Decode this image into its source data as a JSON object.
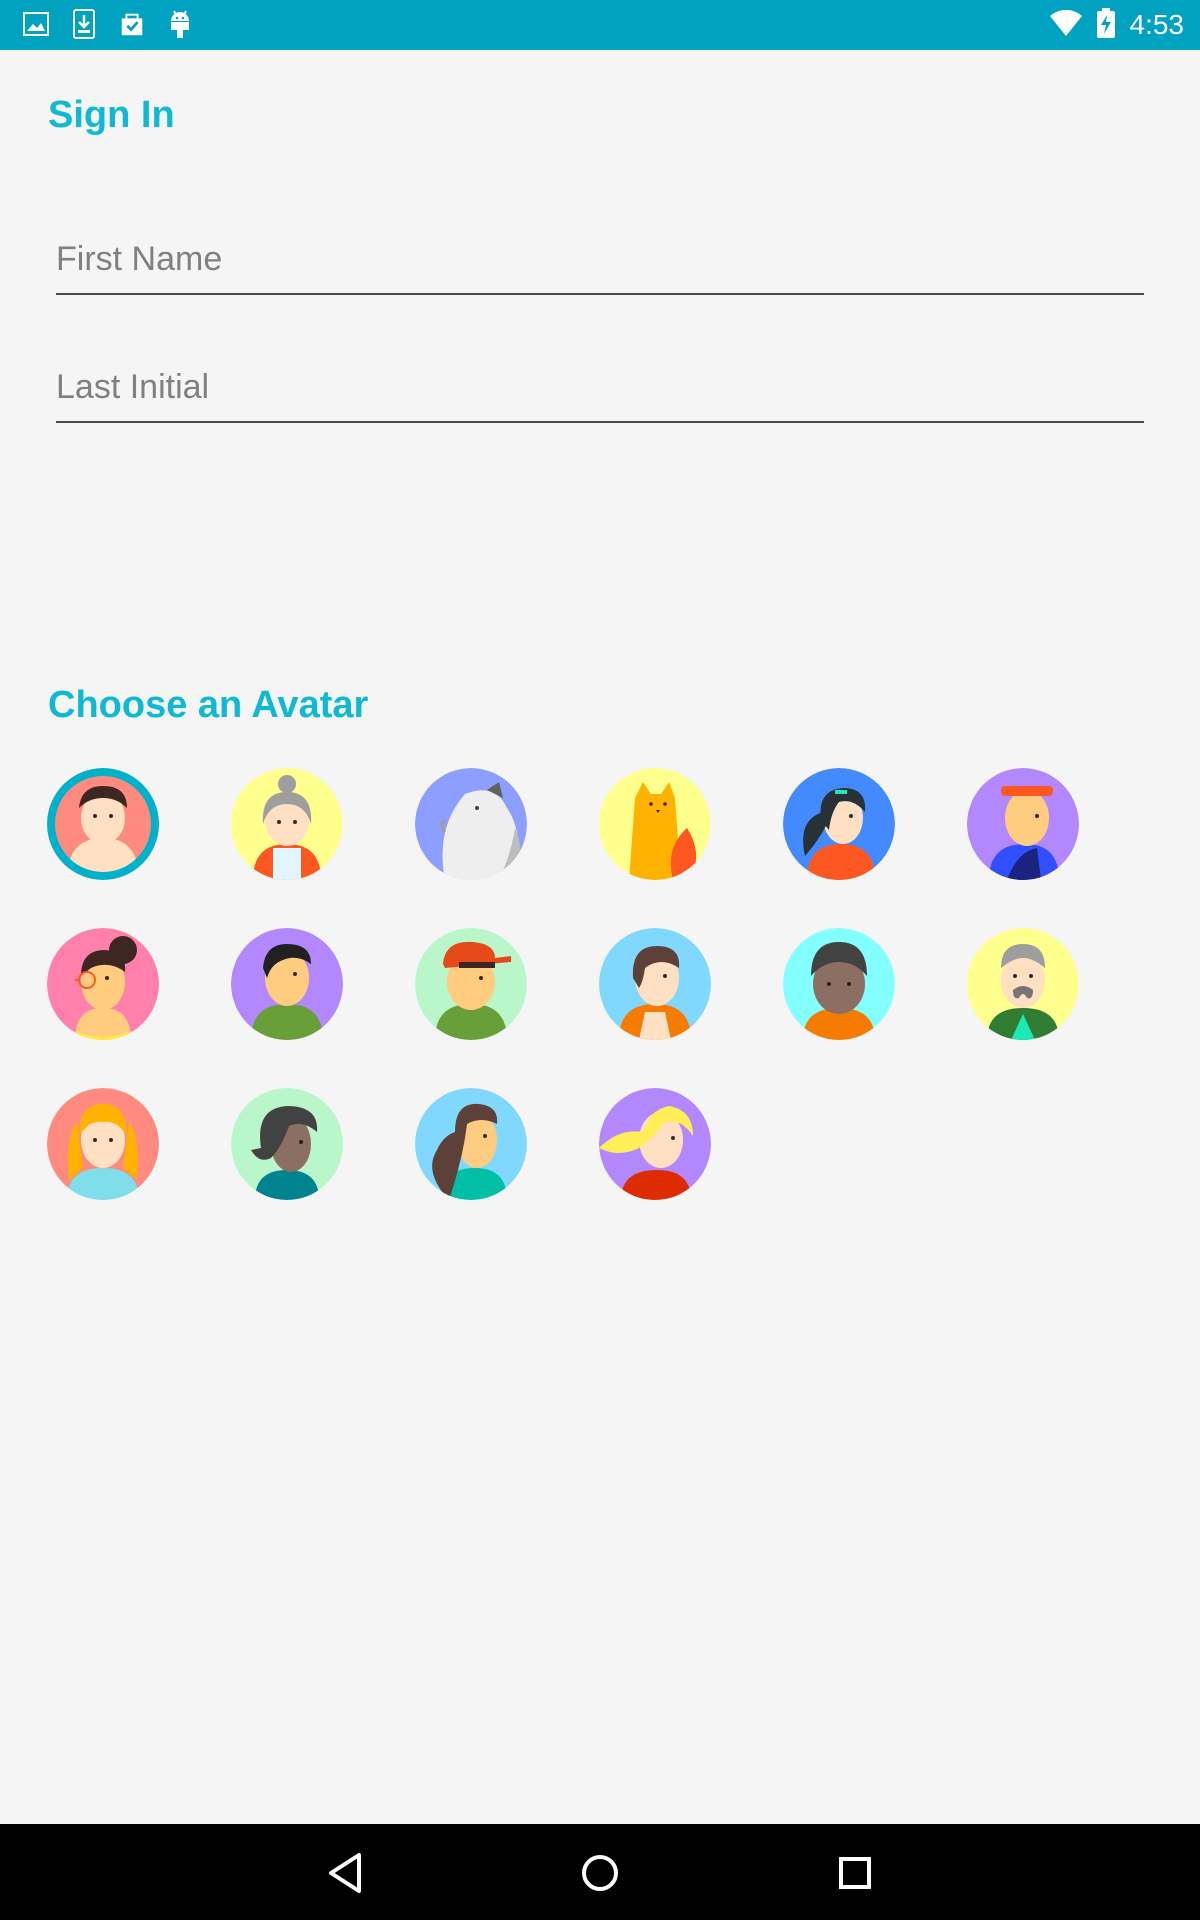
{
  "status_bar": {
    "time": "4:53",
    "left_icons": [
      "image-icon",
      "download-icon",
      "clipboard-check-icon",
      "android-icon"
    ],
    "right_icons": [
      "wifi-icon",
      "battery-charging-icon"
    ]
  },
  "sign_in": {
    "title": "Sign In",
    "first_name_placeholder": "First Name",
    "last_initial_placeholder": "Last Initial"
  },
  "avatars": {
    "title": "Choose an Avatar",
    "items": [
      {
        "name": "avatar-1",
        "bg": "#ff8a80",
        "selected": true
      },
      {
        "name": "avatar-2",
        "bg": "#ffff8d",
        "selected": false
      },
      {
        "name": "avatar-3",
        "bg": "#8c9eff",
        "selected": false
      },
      {
        "name": "avatar-4",
        "bg": "#ffff8d",
        "selected": false
      },
      {
        "name": "avatar-5",
        "bg": "#448aff",
        "selected": false
      },
      {
        "name": "avatar-6",
        "bg": "#b388ff",
        "selected": false
      },
      {
        "name": "avatar-7",
        "bg": "#ff80ab",
        "selected": false
      },
      {
        "name": "avatar-8",
        "bg": "#b388ff",
        "selected": false
      },
      {
        "name": "avatar-9",
        "bg": "#b9f6ca",
        "selected": false
      },
      {
        "name": "avatar-10",
        "bg": "#80d8ff",
        "selected": false
      },
      {
        "name": "avatar-11",
        "bg": "#84ffff",
        "selected": false
      },
      {
        "name": "avatar-12",
        "bg": "#ffff8d",
        "selected": false
      },
      {
        "name": "avatar-13",
        "bg": "#ff8a80",
        "selected": false
      },
      {
        "name": "avatar-14",
        "bg": "#b9f6ca",
        "selected": false
      },
      {
        "name": "avatar-15",
        "bg": "#80d8ff",
        "selected": false
      },
      {
        "name": "avatar-16",
        "bg": "#b388ff",
        "selected": false
      }
    ]
  },
  "nav_bar": {
    "buttons": [
      "back-icon",
      "home-icon",
      "recents-icon"
    ]
  },
  "colors": {
    "status_bar": "#00a2bf",
    "accent": "#0fb8d3",
    "background": "#f5f5f5",
    "selected_ring": "#00b2c9"
  }
}
